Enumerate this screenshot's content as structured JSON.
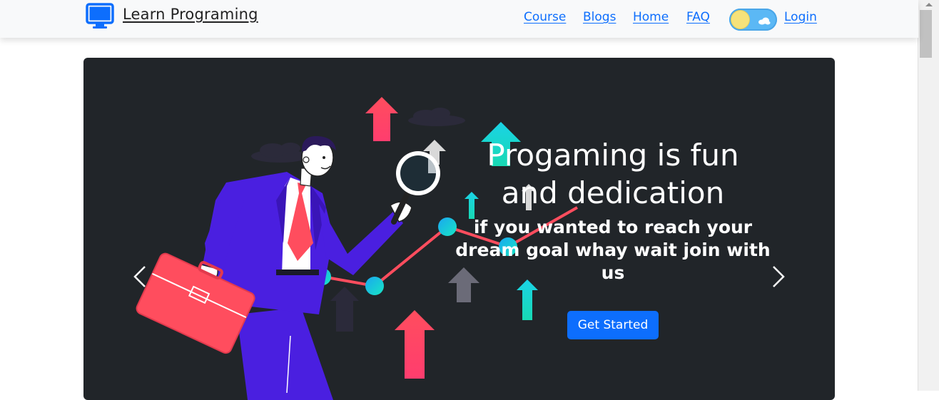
{
  "navbar": {
    "brand": {
      "text": "Learn Programing",
      "icon": "monitor-icon",
      "icon_color": "#0d6efd"
    },
    "links": [
      {
        "label": "Course"
      },
      {
        "label": "Blogs"
      },
      {
        "label": "Home"
      },
      {
        "label": "FAQ"
      }
    ],
    "theme_toggle": {
      "icon": "sun-cloud-icon",
      "state": "light"
    },
    "login": {
      "label": "Login"
    }
  },
  "carousel": {
    "caption": {
      "title": "Progaming is fun and dedication",
      "subtitle": "if you wanted to reach your dream goal whay wait join with us",
      "button": "Get Started"
    },
    "prev_icon": "chevron-left-icon",
    "next_icon": "chevron-right-icon",
    "illustration": "businessman-with-magnifier-and-briefcase-growth-chart"
  },
  "colors": {
    "accent": "#0d6efd",
    "hero_bg": "#212529",
    "navbar_bg": "#f8f9fa",
    "suit": "#4a1fe0",
    "red": "#ff4d5e",
    "cyan": "#1ad3e6"
  }
}
